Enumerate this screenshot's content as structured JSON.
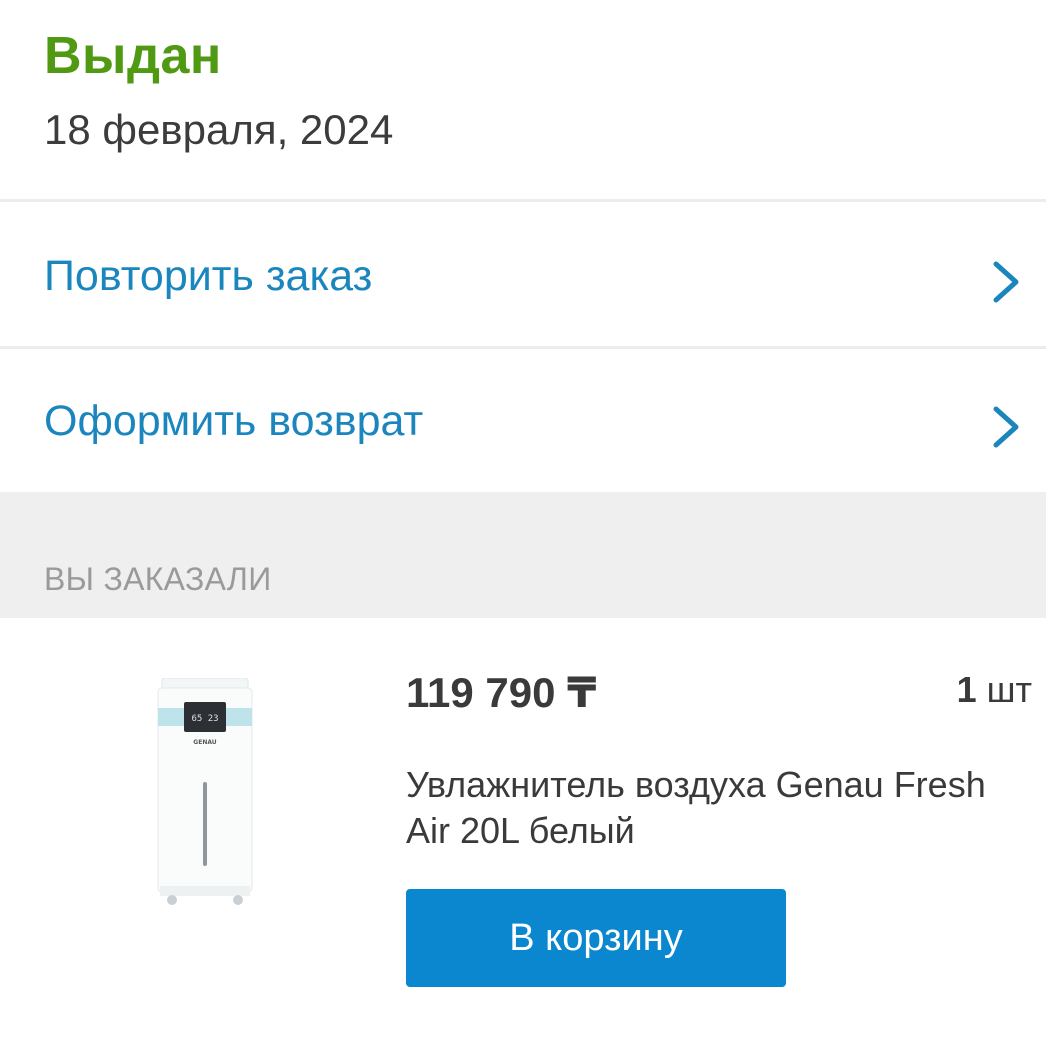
{
  "order_status": {
    "title": "Выдан",
    "date": "18 февраля, 2024",
    "title_color": "#4f9a12"
  },
  "actions": [
    {
      "label": "Повторить заказ",
      "icon": "chevron-right-icon"
    },
    {
      "label": "Оформить возврат",
      "icon": "chevron-right-icon"
    }
  ],
  "ordered_section": {
    "header": "ВЫ ЗАКАЗАЛИ"
  },
  "product": {
    "price": "119 790 ₸",
    "quantity_value": "1",
    "quantity_unit": "шт",
    "name": "Увлажнитель воздуха Genau Fresh Air 20L белый",
    "brand_on_device": "GENAU",
    "display_reading": "65 23"
  },
  "cart_button": {
    "label": "В корзину",
    "color": "#0a87cf"
  },
  "theme": {
    "link_color": "#1b86bd",
    "section_bg": "#efefef"
  }
}
